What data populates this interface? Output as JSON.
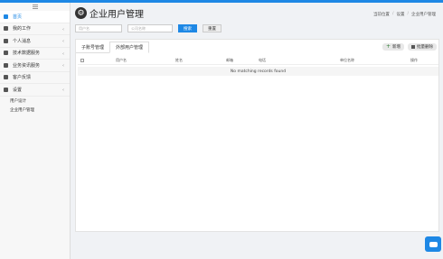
{
  "sidebar": {
    "items": [
      {
        "label": "首页",
        "active": true,
        "chev": ""
      },
      {
        "label": "我的工作",
        "active": false,
        "chev": "‹"
      },
      {
        "label": "个人消息",
        "active": false,
        "chev": "‹"
      },
      {
        "label": "技术数据服务",
        "active": false,
        "chev": "‹"
      },
      {
        "label": "业务资讯服务",
        "active": false,
        "chev": "‹"
      },
      {
        "label": "客户反馈",
        "active": false,
        "chev": ""
      },
      {
        "label": "设置",
        "active": false,
        "chev": "‹"
      }
    ],
    "sub_items": [
      "用户设计",
      "企业用户管理"
    ]
  },
  "page": {
    "title": "企业用户管理"
  },
  "breadcrumb": {
    "home": "当前位置",
    "sep": "/",
    "level1": "设置",
    "level2": "企业用户管理"
  },
  "search": {
    "username_placeholder": "用户名",
    "company_placeholder": "公司名称",
    "search_label": "搜索",
    "reset_label": "重置"
  },
  "tabs": [
    "子账号管理",
    "外部用户管理"
  ],
  "actions": {
    "add_label": "新增",
    "batch_delete_label": "批量删除"
  },
  "table": {
    "columns": [
      "用户名",
      "姓名",
      "邮箱",
      "电话",
      "单位名称",
      "操作"
    ],
    "empty_message": "No matching records found"
  },
  "colors": {
    "accent": "#1e88e5"
  }
}
